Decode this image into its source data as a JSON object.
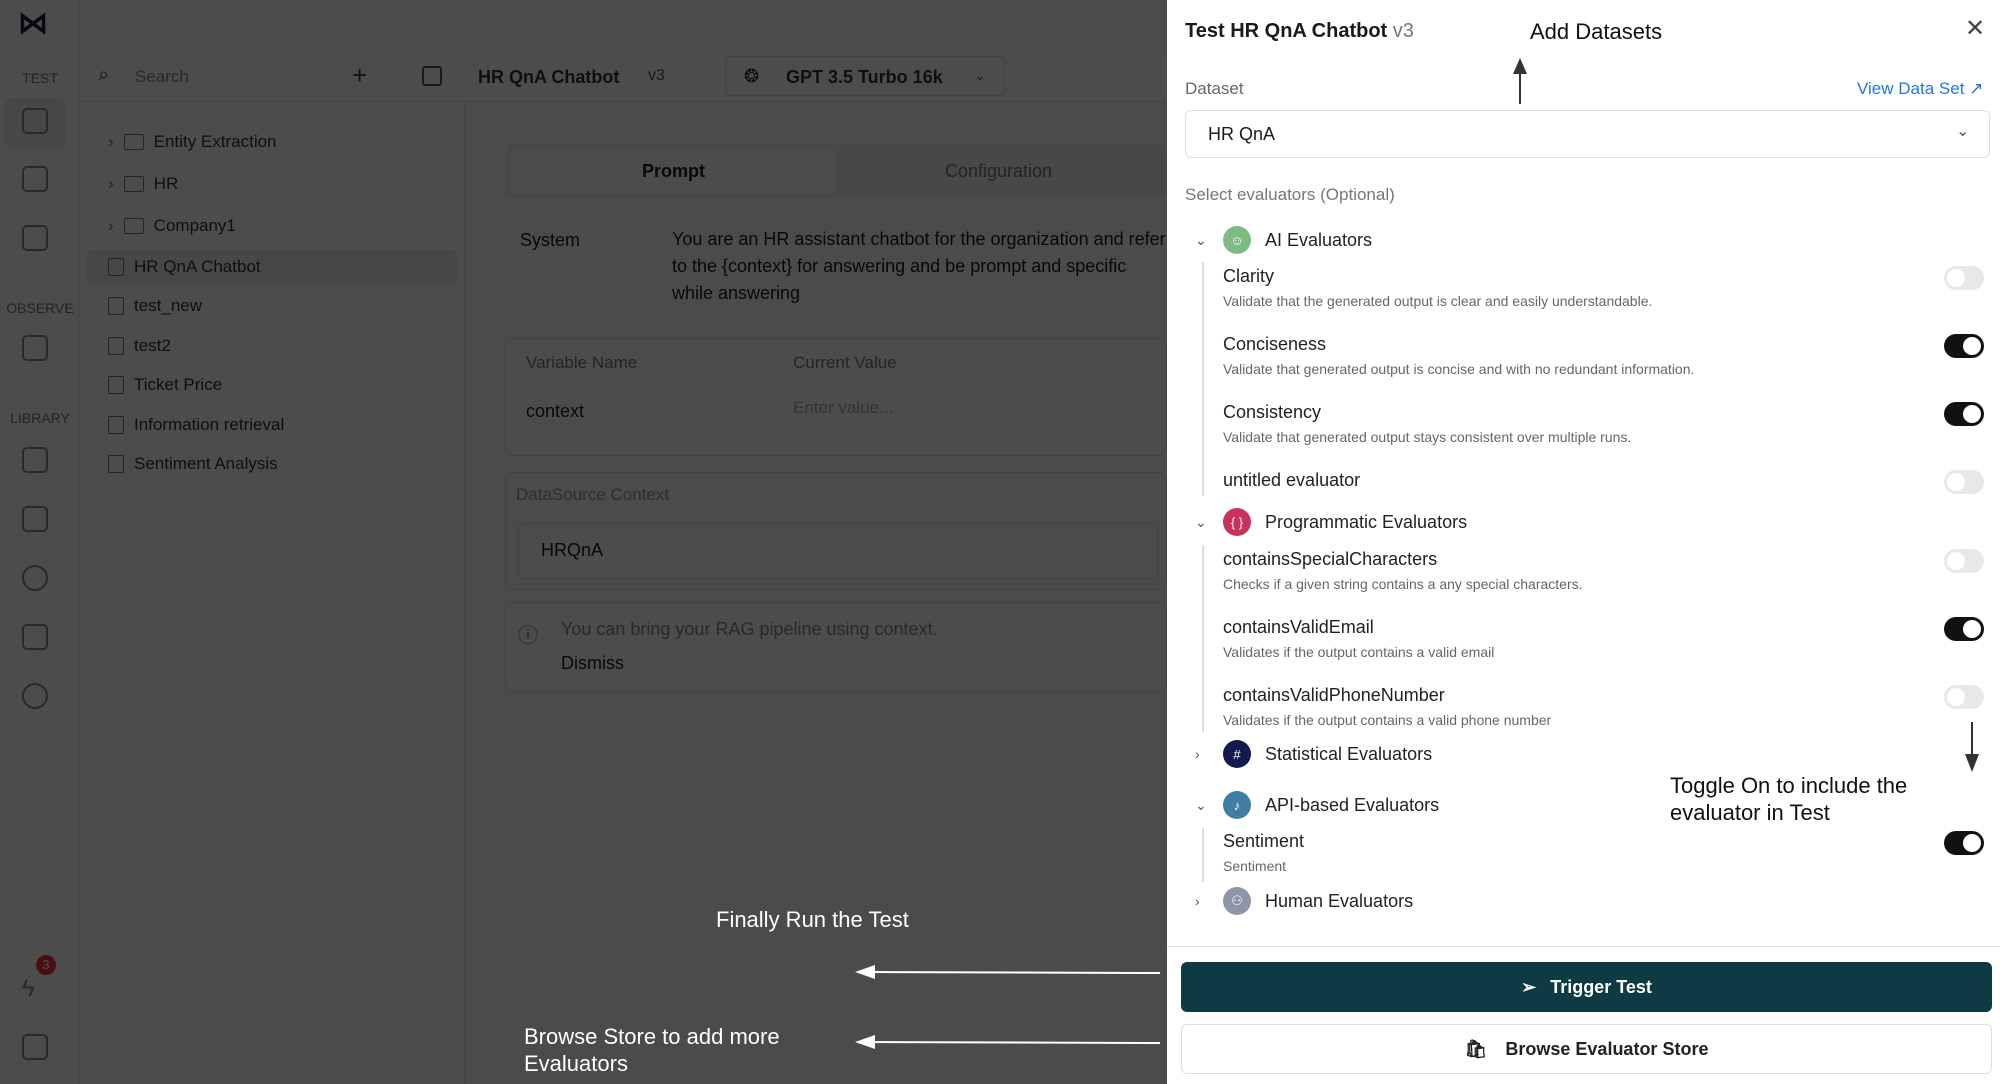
{
  "rail": {
    "sections": [
      "TEST",
      "OBSERVE",
      "LIBRARY"
    ],
    "badge": "3"
  },
  "topbar": {
    "search_placeholder": "Search",
    "prompt_name": "HR QnA Chatbot",
    "version": "v3",
    "model": "GPT 3.5 Turbo 16k"
  },
  "tree": [
    "Entity Extraction",
    "HR",
    "Company1",
    "HR QnA Chatbot",
    "test_new",
    "test2",
    "Ticket Price",
    "Information retrieval",
    "Sentiment Analysis"
  ],
  "main": {
    "tabs": [
      "Prompt",
      "Configuration"
    ],
    "role": "System",
    "system_prompt": "You are an HR assistant chatbot for the organization and refer to the {context} for answering and be prompt and specific while answering",
    "var_headers": [
      "Variable Name",
      "Current Value"
    ],
    "var_name": "context",
    "var_placeholder": "Enter value...",
    "ds_label": "DataSource Context",
    "ds_value": "HRQnA",
    "notice": "You can bring your RAG pipeline using context.",
    "dismiss": "Dismiss"
  },
  "panel": {
    "title": "Test HR QnA Chatbot",
    "version": "v3",
    "dataset_label": "Dataset",
    "view_link": "View Data Set ↗",
    "dataset_value": "HR QnA",
    "evaluators_label": "Select evaluators (Optional)",
    "groups": [
      {
        "name": "AI Evaluators",
        "color": "#7dbb83",
        "icon": "robot-icon",
        "expanded": true,
        "items": [
          {
            "name": "Clarity",
            "desc": "Validate that the generated output is clear and easily understandable.",
            "on": false
          },
          {
            "name": "Conciseness",
            "desc": "Validate that generated output is concise and with no redundant information.",
            "on": true
          },
          {
            "name": "Consistency",
            "desc": "Validate that generated output stays consistent over multiple runs.",
            "on": true
          },
          {
            "name": "untitled evaluator",
            "desc": "",
            "on": false
          }
        ]
      },
      {
        "name": "Programmatic Evaluators",
        "color": "#c9325d",
        "icon": "braces-icon",
        "expanded": true,
        "items": [
          {
            "name": "containsSpecialCharacters",
            "desc": "Checks if a given string contains a any special characters.",
            "on": false
          },
          {
            "name": "containsValidEmail",
            "desc": "Validates if the output contains a valid email",
            "on": true
          },
          {
            "name": "containsValidPhoneNumber",
            "desc": "Validates if the output contains a valid phone number",
            "on": false
          }
        ]
      },
      {
        "name": "Statistical Evaluators",
        "color": "#121a4e",
        "icon": "hash-icon",
        "expanded": false,
        "items": []
      },
      {
        "name": "API-based Evaluators",
        "color": "#3f7fa3",
        "icon": "api-icon",
        "expanded": true,
        "items": [
          {
            "name": "Sentiment",
            "desc": "Sentiment",
            "on": true
          }
        ]
      },
      {
        "name": "Human Evaluators",
        "color": "#8d97a8",
        "icon": "person-icon",
        "expanded": false,
        "items": []
      }
    ],
    "trigger": "Trigger Test",
    "browse": "Browse Evaluator Store",
    "primary_color": "#0e3b43"
  },
  "annotations": {
    "add_datasets": "Add Datasets",
    "toggle": "Toggle On to include the evaluator in Test",
    "run": "Finally Run the Test",
    "browse": "Browse Store to add more Evaluators"
  }
}
